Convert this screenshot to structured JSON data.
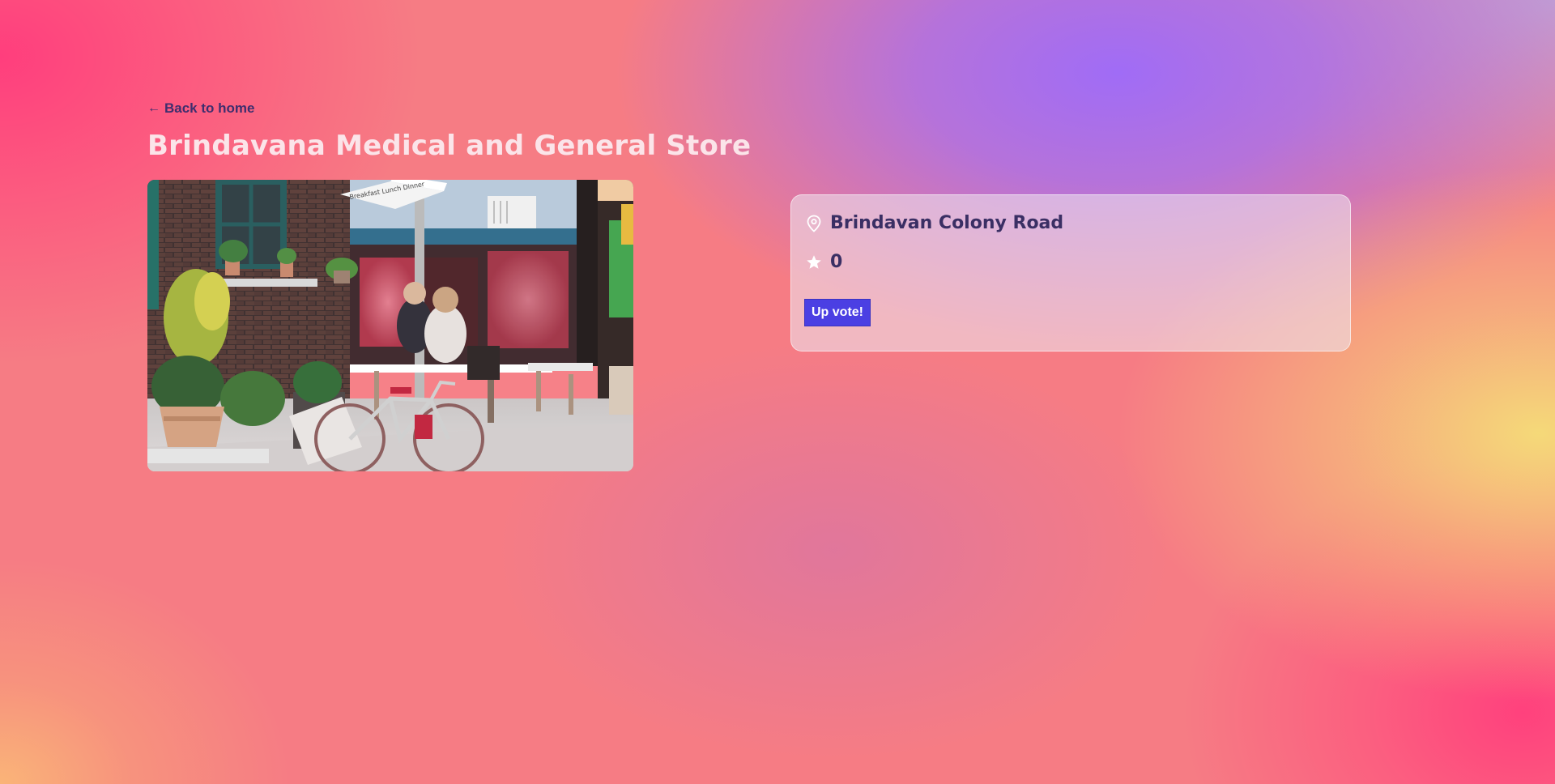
{
  "nav": {
    "back_arrow": "←",
    "back_label": "Back to home"
  },
  "store": {
    "name": "Brindavana Medical and General Store",
    "address": "Brindavan Colony Road",
    "votes": "0",
    "upvote_label": "Up vote!",
    "photo_sign_text": "Breakfast Lunch Dinner"
  },
  "icons": {
    "address": "map-pin-icon",
    "votes": "star-icon",
    "back": "arrow-left-icon"
  },
  "colors": {
    "button": "#4b3fe3",
    "text_dark": "#3a2f64",
    "title": "#fbe4e9"
  }
}
